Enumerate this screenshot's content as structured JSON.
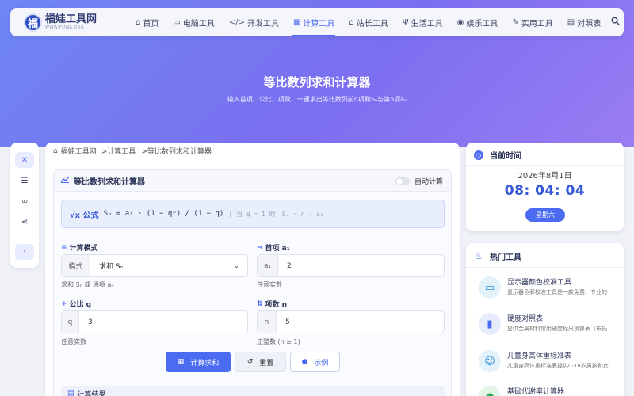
{
  "brand": {
    "name": "福娃工具网",
    "domain": "WWW.FUWA.ORG",
    "mark": "福"
  },
  "nav": {
    "items": [
      {
        "icon": "home-icon",
        "glyph": "⌂",
        "label": "首页",
        "active": false
      },
      {
        "icon": "computer-icon",
        "glyph": "▭",
        "label": "电脑工具",
        "active": false
      },
      {
        "icon": "code-icon",
        "glyph": "</>",
        "label": "开发工具",
        "active": false
      },
      {
        "icon": "calculator-icon",
        "glyph": "▦",
        "label": "计算工具",
        "active": true
      },
      {
        "icon": "webmaster-icon",
        "glyph": "⌂",
        "label": "站长工具",
        "active": false
      },
      {
        "icon": "utensils-icon",
        "glyph": "Ψ",
        "label": "生活工具",
        "active": false
      },
      {
        "icon": "gamepad-icon",
        "glyph": "◉",
        "label": "娱乐工具",
        "active": false
      },
      {
        "icon": "wrench-icon",
        "glyph": "✎",
        "label": "实用工具",
        "active": false
      },
      {
        "icon": "table-icon",
        "glyph": "▤",
        "label": "对照表",
        "active": false
      }
    ],
    "search_icon": "search-icon"
  },
  "hero": {
    "title": "等比数列求和计算器",
    "subtitle": "输入首项、公比、项数，一键求出等比数列前n项和Sₙ与第n项aₙ"
  },
  "breadcrumb": {
    "home": "福娃工具网",
    "category": ">计算工具",
    "current": ">等比数列求和计算器"
  },
  "tool": {
    "title": "等比数列求和计算器",
    "auto_calc_label": "自动计算",
    "auto_calc_on": false,
    "formula_label": "√x 公式",
    "formula": "Sₙ = a₁ · (1 − qⁿ) / (1 − q)",
    "formula_note": "| 当 q = 1 时，Sₙ = n · a₁",
    "mode": {
      "label": "计算模式",
      "addon": "模式",
      "value": "求和 Sₙ",
      "hint": "求和 Sₙ 或 通项 aₙ"
    },
    "first_term": {
      "label": "首项 a₁",
      "addon": "a₁",
      "value": "2",
      "hint": "任意实数"
    },
    "ratio": {
      "label": "公比 q",
      "addon": "q",
      "value": "3",
      "hint": "任意实数"
    },
    "terms": {
      "label": "项数 n",
      "addon": "n",
      "value": "5",
      "hint": "正整数 (n ≥ 1)"
    },
    "buttons": {
      "calculate": "计算求和",
      "reset": "重置",
      "example": "示例"
    },
    "result_label": "计算结果"
  },
  "clock": {
    "title": "当前时间",
    "date": "2026年8月1日",
    "time": "08: 04: 04",
    "weekday": "星期六"
  },
  "hot": {
    "title": "热门工具",
    "items": [
      {
        "icon": "monitor-icon",
        "name": "显示器颜色校准工具",
        "desc": "显示器色彩校准工具是一款免费、专业的"
      },
      {
        "icon": "hardness-icon",
        "name": "硬度对照表",
        "desc": "提供金属材料常用硬度标尺换算表（布氏"
      },
      {
        "icon": "child-icon",
        "name": "儿童身高体重标准表",
        "desc": "儿童身高体重标准表提供0-18岁男孩和女"
      },
      {
        "icon": "metabolism-icon",
        "name": "基础代谢率计算器",
        "desc": ""
      }
    ]
  },
  "colors": {
    "accent": "#4b6cf0",
    "hero_start": "#6e86f3",
    "hero_end": "#9a7cf3",
    "page_bg": "#f0f2f8"
  }
}
